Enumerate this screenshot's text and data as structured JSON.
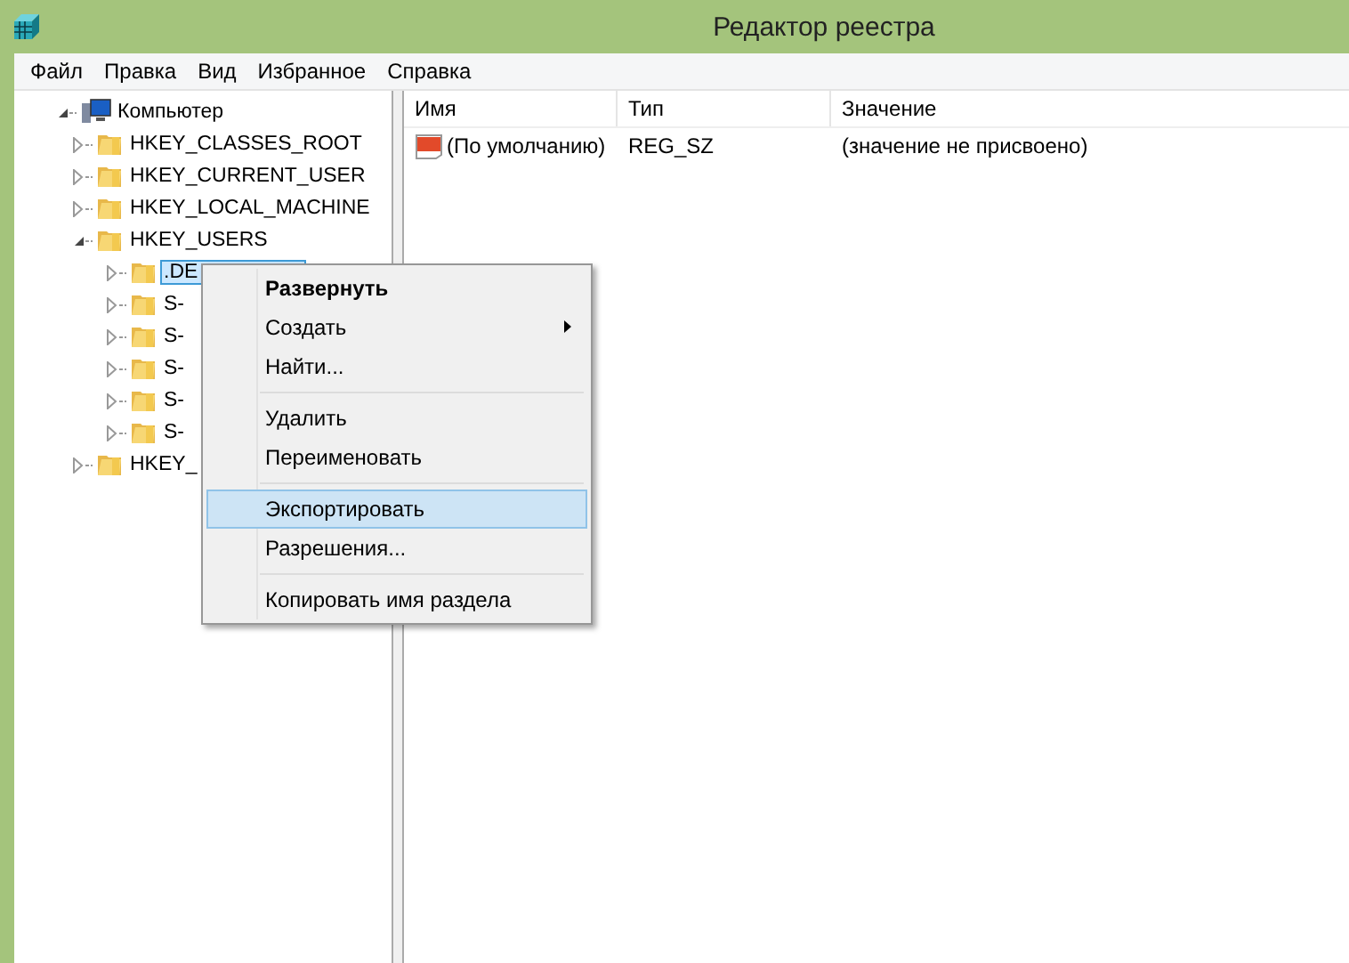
{
  "window": {
    "title": "Редактор реестра"
  },
  "menu_bar": [
    "Файл",
    "Правка",
    "Вид",
    "Избранное",
    "Справка"
  ],
  "tree": [
    {
      "label": "Компьютер",
      "kind": "computer",
      "expanded": true,
      "selected": false,
      "children": [
        {
          "label": "HKEY_CLASSES_ROOT",
          "kind": "folder",
          "expanded": false,
          "selected": false
        },
        {
          "label": "HKEY_CURRENT_USER",
          "kind": "folder",
          "expanded": false,
          "selected": false
        },
        {
          "label": "HKEY_LOCAL_MACHINE",
          "kind": "folder",
          "expanded": false,
          "selected": false
        },
        {
          "label": "HKEY_USERS",
          "kind": "folder",
          "expanded": true,
          "selected": false,
          "children": [
            {
              "label": ".DE",
              "kind": "folder",
              "expanded": false,
              "selected": true
            },
            {
              "label": "S-",
              "kind": "folder",
              "expanded": false,
              "selected": false
            },
            {
              "label": "S-",
              "kind": "folder",
              "expanded": false,
              "selected": false
            },
            {
              "label": "S-",
              "kind": "folder",
              "expanded": false,
              "selected": false
            },
            {
              "label": "S-",
              "kind": "folder",
              "expanded": false,
              "selected": false
            },
            {
              "label": "S-",
              "kind": "folder",
              "expanded": false,
              "selected": false
            }
          ]
        },
        {
          "label": "HKEY_",
          "kind": "folder",
          "expanded": false,
          "selected": false
        }
      ]
    }
  ],
  "table": {
    "columns": [
      "Имя",
      "Тип",
      "Значение"
    ],
    "rows": [
      {
        "name": "(По умолчанию)",
        "type": "REG_SZ",
        "value": "(значение не присвоено)"
      }
    ]
  },
  "context_menu": [
    {
      "kind": "item",
      "label": "Развернуть",
      "default": true,
      "submenu": false,
      "selected": false
    },
    {
      "kind": "item",
      "label": "Создать",
      "default": false,
      "submenu": true,
      "selected": false
    },
    {
      "kind": "item",
      "label": "Найти...",
      "default": false,
      "submenu": false,
      "selected": false
    },
    {
      "kind": "separator"
    },
    {
      "kind": "item",
      "label": "Удалить",
      "default": false,
      "submenu": false,
      "selected": false
    },
    {
      "kind": "item",
      "label": "Переименовать",
      "default": false,
      "submenu": false,
      "selected": false
    },
    {
      "kind": "separator"
    },
    {
      "kind": "item",
      "label": "Экспортировать",
      "default": false,
      "submenu": false,
      "selected": true
    },
    {
      "kind": "item",
      "label": "Разрешения...",
      "default": false,
      "submenu": false,
      "selected": false
    },
    {
      "kind": "separator"
    },
    {
      "kind": "item",
      "label": "Копировать имя раздела",
      "default": false,
      "submenu": false,
      "selected": false
    }
  ]
}
